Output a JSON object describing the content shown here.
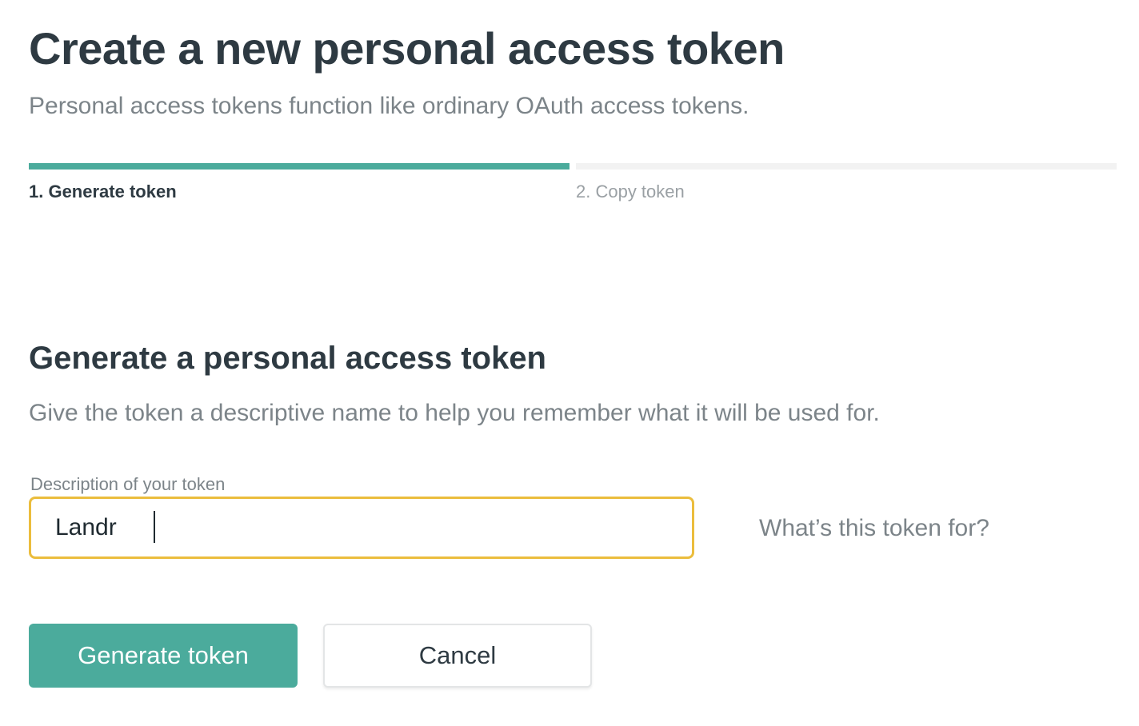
{
  "header": {
    "title": "Create a new personal access token",
    "subtitle": "Personal access tokens function like ordinary OAuth access tokens."
  },
  "stepper": {
    "steps": [
      {
        "label": "1. Generate token",
        "active": true
      },
      {
        "label": "2. Copy token",
        "active": false
      }
    ]
  },
  "section": {
    "title": "Generate a personal access token",
    "description": "Give the token a descriptive name to help you remember what it will be used for."
  },
  "form": {
    "description_label": "Description of your token",
    "description_value": "Landr",
    "help_link": "What’s this token for?"
  },
  "actions": {
    "generate_label": "Generate token",
    "cancel_label": "Cancel"
  },
  "colors": {
    "accent": "#4bab9c",
    "focus_border": "#ebbd3d",
    "heading_text": "#2e3a42",
    "muted_text": "#7c8489"
  }
}
